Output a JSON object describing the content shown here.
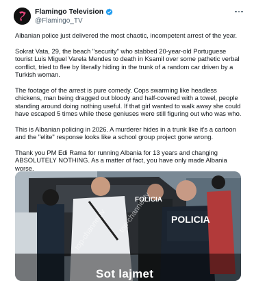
{
  "account": {
    "name": "Flamingo Television",
    "handle": "@Flamingo_TV",
    "verified_color": "#1d9bf0",
    "avatar_icon": "flamingo-logo-icon"
  },
  "tweet": {
    "paragraphs": [
      "Albanian police just delivered the most chaotic, incompetent arrest of the year.",
      "Sokrat Vata, 29, the beach \"security\" who stabbed 20-year-old Portuguese tourist Luis Miguel Varela Mendes to death in Ksamil over some pathetic verbal conflict, tried to flee by literally hiding in the trunk of a random car driven by a Turkish woman.",
      "The footage of the arrest is pure comedy. Cops swarming like headless chickens, man being dragged out bloody and half-covered with a towel, people standing around doing nothing useful. If that girl wanted to walk away she could have escaped 5 times while these geniuses were still figuring out who was who.",
      "This is Albanian policing in 2026. A murderer hides in a trunk like it's a cartoon and the \"elite\" response looks like a school group project gone wrong.",
      "Thank you PM Edi Rama for running Albania for 13 years and changing ABSOLUTELY NOTHING. As a matter of fact, you have only made Albania worse."
    ]
  },
  "media": {
    "vest_text_1": "FOLICIA",
    "vest_text_2": "POLICIA",
    "watermark": "top-channel.tv",
    "caption": "Sot lajmet"
  }
}
